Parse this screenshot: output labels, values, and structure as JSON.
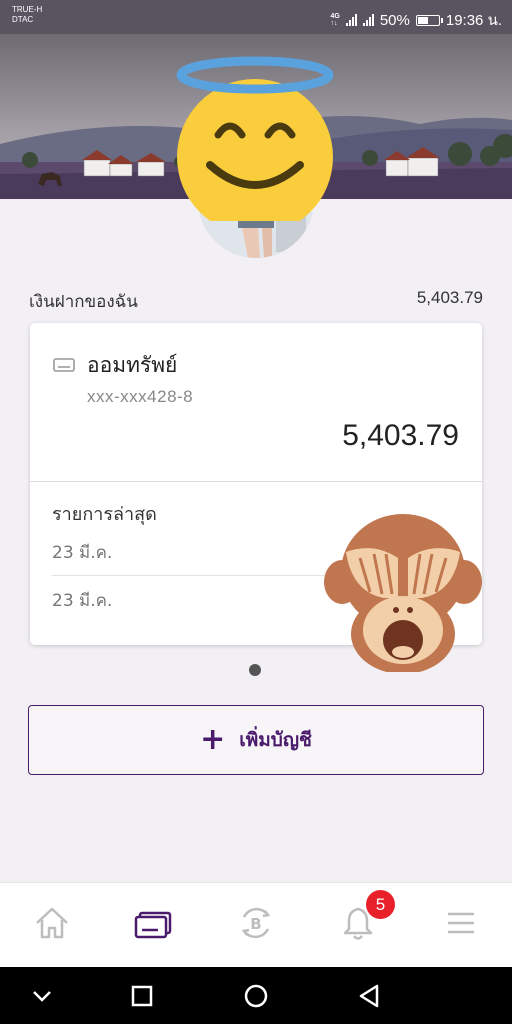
{
  "status_bar": {
    "carrier_1": "TRUE-H",
    "carrier_2": "DTAC",
    "network_badge_top": "4G",
    "network_badge_bottom": "↑↓",
    "battery": "50%",
    "battery_level": 0.5,
    "time": "19:36 น."
  },
  "header": {
    "avatar_icon": "profile-photo",
    "overlay_emoji_1": "smiling-face-with-halo-emoji",
    "overlay_emoji_2": "see-no-evil-monkey-emoji"
  },
  "deposits": {
    "label": "เงินฝากของฉัน",
    "total": "5,403.79"
  },
  "account_card": {
    "icon": "account-card-icon",
    "name": "ออมทรัพย์",
    "number": "xxx-xxx428-8",
    "balance": "5,403.79",
    "recent_title": "รายการล่าสุด",
    "transactions": [
      {
        "date": "23 มี.ค."
      },
      {
        "date": "23 มี.ค."
      }
    ]
  },
  "pager": {
    "pages": 1,
    "current": 1
  },
  "add_account": {
    "icon": "+",
    "label": "เพิ่มบัญชี"
  },
  "bottom_nav": {
    "items": [
      {
        "icon": "home-icon",
        "active": false
      },
      {
        "icon": "accounts-card-icon",
        "active": true
      },
      {
        "icon": "bitcoin-exchange-icon",
        "active": false
      },
      {
        "icon": "bell-icon",
        "active": false,
        "badge": "5"
      },
      {
        "icon": "menu-icon",
        "active": false
      }
    ],
    "active_color": "#4a1a6b",
    "inactive_color": "#bdbdbd",
    "badge_color": "#e8202a"
  },
  "system_nav": {
    "buttons": [
      "chevron-down-icon",
      "recents-square-icon",
      "home-circle-icon",
      "back-triangle-icon"
    ]
  },
  "colors": {
    "brand_purple": "#4a1a6b",
    "background": "#f2f0f4"
  }
}
